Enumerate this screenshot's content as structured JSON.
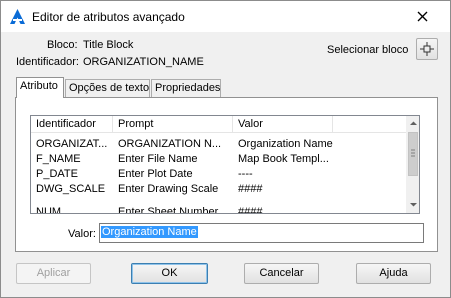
{
  "window": {
    "title": "Editor de atributos avançado"
  },
  "block": {
    "label": "Bloco:",
    "value": "Title Block"
  },
  "tag": {
    "label": "Identificador:",
    "value": "ORGANIZATION_NAME"
  },
  "select_block": {
    "label": "Selecionar bloco",
    "icon": "crosshair-pick-icon"
  },
  "tabs": [
    {
      "label": "Atributo",
      "active": true
    },
    {
      "label": "Opções de texto",
      "active": false
    },
    {
      "label": "Propriedades",
      "active": false
    }
  ],
  "table": {
    "columns": [
      "Identificador",
      "Prompt",
      "Valor"
    ],
    "rows": [
      {
        "tag": "ORGANIZAT...",
        "prompt": "ORGANIZATION N...",
        "value": "Organization Name"
      },
      {
        "tag": "F_NAME",
        "prompt": "Enter File Name",
        "value": "Map Book Templ..."
      },
      {
        "tag": "P_DATE",
        "prompt": "Enter Plot Date",
        "value": "----"
      },
      {
        "tag": "DWG_SCALE",
        "prompt": "Enter Drawing Scale",
        "value": "####"
      },
      {
        "tag": "NUM...",
        "prompt": "Enter Sheet Number",
        "value": "####"
      }
    ]
  },
  "value_field": {
    "label": "Valor:",
    "value": "Organization Name"
  },
  "buttons": {
    "apply": "Aplicar",
    "ok": "OK",
    "cancel": "Cancelar",
    "help": "Ajuda"
  },
  "colors": {
    "selection": "#3399ff",
    "app_icon": "#0a6bd6"
  }
}
